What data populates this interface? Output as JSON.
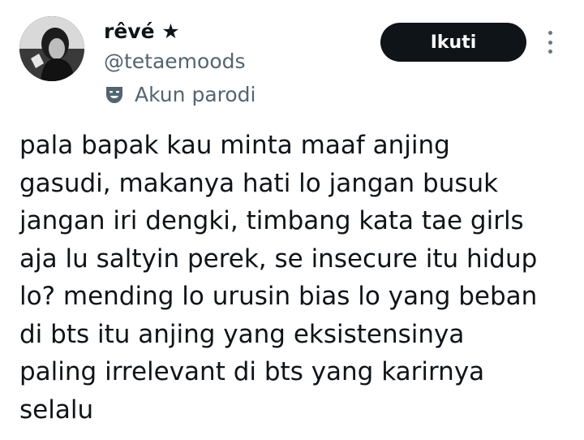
{
  "author": {
    "display_name": "rêvé ★",
    "handle": "@tetaemoods",
    "account_label": "Akun parodi",
    "label_icon": "parody-mask-icon"
  },
  "actions": {
    "follow_label": "Ikuti",
    "more_icon": "more-vertical-icon"
  },
  "tweet": {
    "text": "pala bapak kau minta maaf anjing\ngasudi, makanya hati lo jangan busuk\njangan iri dengki, timbang kata tae girls\naja lu saltyin perek, se insecure itu hidup\nlo? mending lo urusin bias lo yang beban\ndi bts itu anjing yang eksistensinya\npaling irrelevant di bts yang karirnya\nselalu"
  },
  "colors": {
    "text_primary": "#0f1419",
    "text_secondary": "#536471",
    "button_bg": "#0f1419",
    "button_text": "#ffffff"
  }
}
